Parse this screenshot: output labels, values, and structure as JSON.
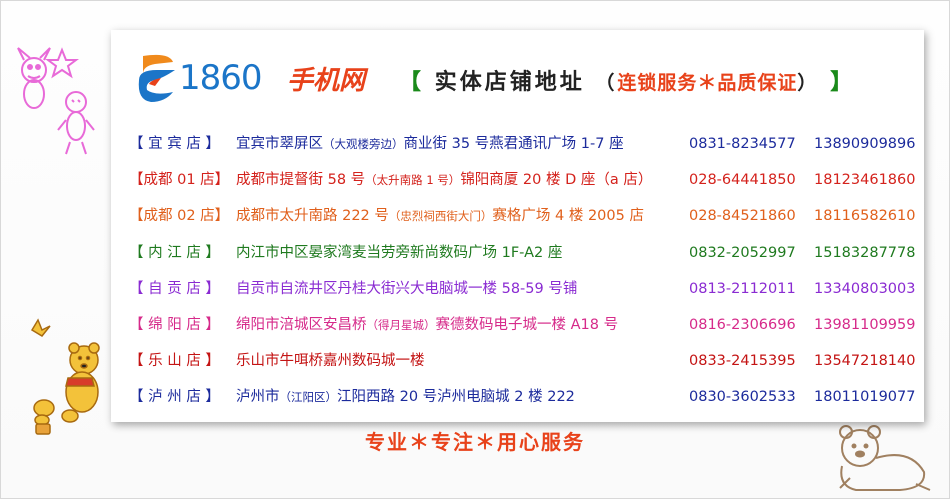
{
  "logo": {
    "number": "1860",
    "name": "手机网",
    "colors": {
      "blue": "#1b75c8",
      "orange": "#f08a1c",
      "red": "#e8421a"
    }
  },
  "title": {
    "open_bracket": "【",
    "main": "实体店铺地址",
    "paren_open": "（",
    "sub": "连锁服务＊品质保证",
    "paren_close": "）",
    "close_bracket": "】"
  },
  "stores": [
    {
      "store": "【 宜 宾 店 】",
      "address": "宜宾市翠屏区",
      "address_note": "（大观楼旁边）",
      "address_rest": "商业街 35 号燕君通讯广场 1-7 座",
      "tel": "0831-8234577",
      "mobile": "13890909896",
      "color": "#1c2b9c"
    },
    {
      "store": "【成都 01 店】",
      "address": "成都市提督街 58 号",
      "address_note": "（太升南路 1 号）",
      "address_rest": "锦阳商厦 20 楼 D 座（a 店）",
      "tel": "028-64441850",
      "mobile": "18123461860",
      "color": "#d4221c"
    },
    {
      "store": "【成都 02 店】",
      "address": "成都市太升南路 222 号",
      "address_note": "（忠烈祠西街大门）",
      "address_rest": "赛格广场 4 楼 2005 店",
      "tel": "028-84521860",
      "mobile": "18116582610",
      "color": "#e0601c"
    },
    {
      "store": "【 内 江 店 】",
      "address": "内江市中区晏家湾麦当劳旁新尚数码广场 1F-A2 座",
      "address_note": "",
      "address_rest": "",
      "tel": "0832-2052997",
      "mobile": "15183287778",
      "color": "#1f7a1f"
    },
    {
      "store": "【 自 贡 店 】",
      "address": "自贡市自流井区丹桂大街兴大电脑城一楼 58-59 号铺",
      "address_note": "",
      "address_rest": "",
      "tel": "0813-2112011",
      "mobile": "13340803003",
      "color": "#8a2bd2"
    },
    {
      "store": "【 绵 阳 店 】",
      "address": "绵阳市涪城区安昌桥",
      "address_note": "（得月星城）",
      "address_rest": "赛德数码电子城一楼 A18 号",
      "tel": "0816-2306696",
      "mobile": "13981109959",
      "color": "#d62a8a"
    },
    {
      "store": "【 乐 山 店 】",
      "address": "乐山市牛咡桥嘉州数码城一楼",
      "address_note": "",
      "address_rest": "",
      "tel": "0833-2415395",
      "mobile": "13547218140",
      "color": "#c41414"
    },
    {
      "store": "【 泸 州 店 】",
      "address": "泸州市",
      "address_note": "（江阳区）",
      "address_rest": "江阳西路 20 号泸州电脑城 2 楼 222",
      "tel": "0830-3602533",
      "mobile": "18011019077",
      "color": "#1c2b9c"
    }
  ],
  "slogan": "专业＊专注＊用心服务",
  "decorations": {
    "top_left": "piglet-cartoon-icon",
    "bottom_left": "pooh-bear-cartoon-icon",
    "bottom_right": "pooh-bear-sketch-icon"
  }
}
